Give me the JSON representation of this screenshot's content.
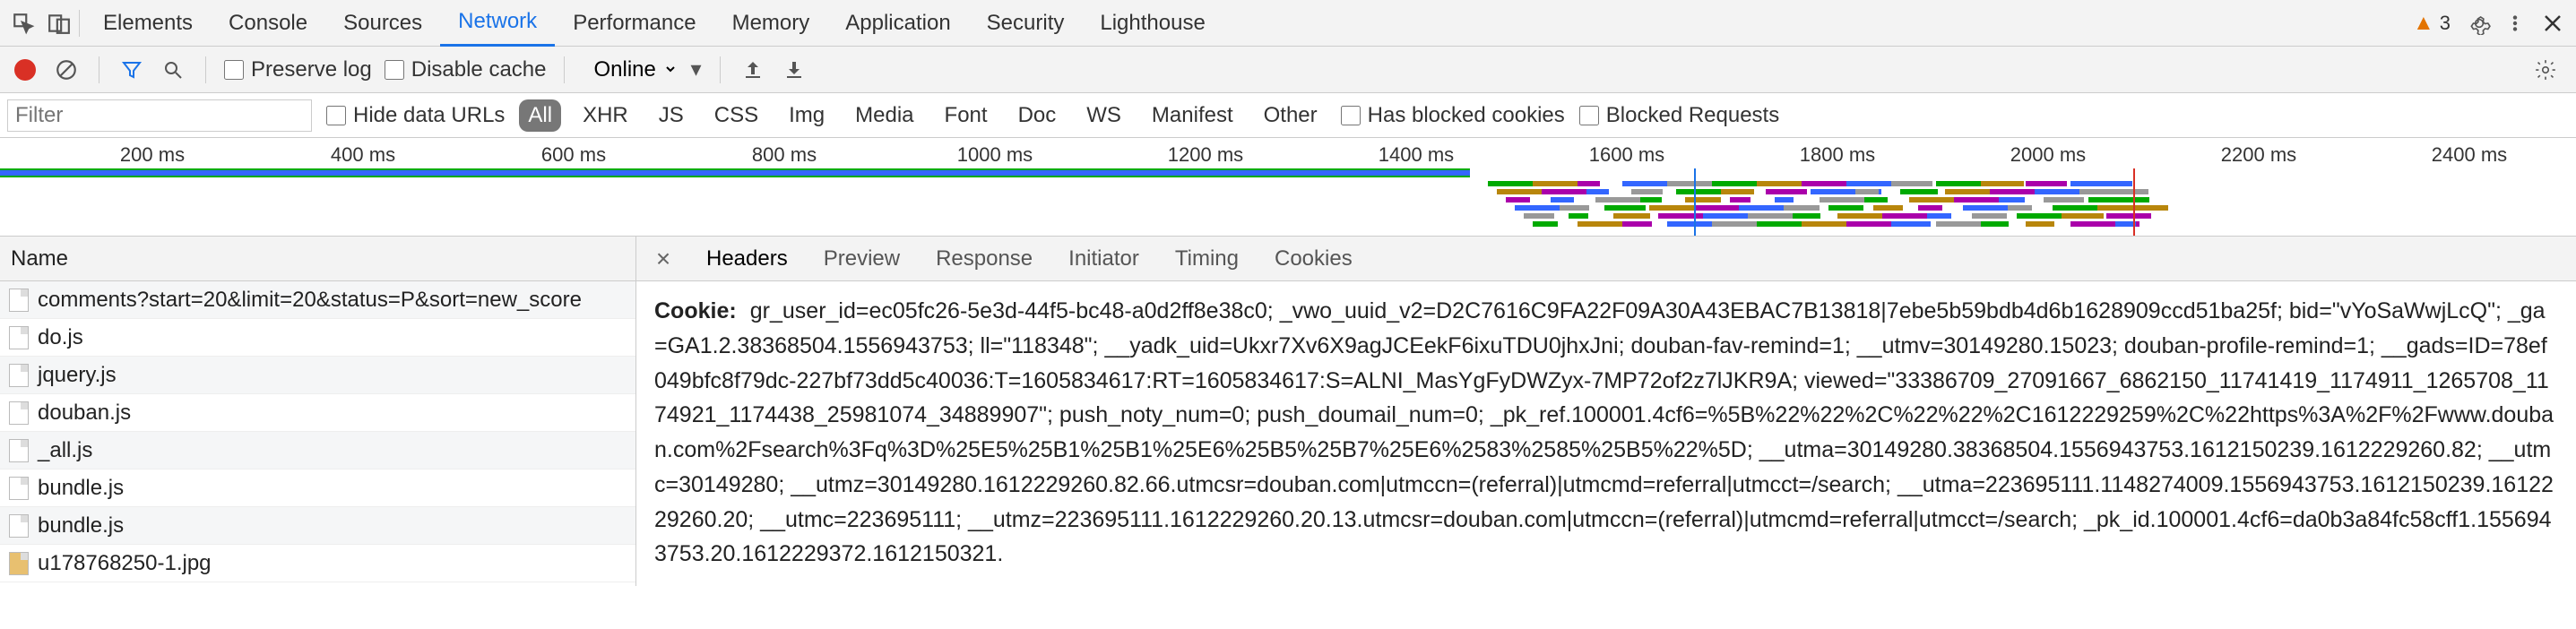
{
  "topTabs": [
    "Elements",
    "Console",
    "Sources",
    "Network",
    "Performance",
    "Memory",
    "Application",
    "Security",
    "Lighthouse"
  ],
  "topActive": "Network",
  "warnings": "3",
  "sub": {
    "preserve": "Preserve log",
    "disable": "Disable cache",
    "throttle": "Online"
  },
  "filter": {
    "placeholder": "Filter",
    "hideData": "Hide data URLs",
    "types": [
      "All",
      "XHR",
      "JS",
      "CSS",
      "Img",
      "Media",
      "Font",
      "Doc",
      "WS",
      "Manifest",
      "Other"
    ],
    "typeActive": "All",
    "blockedCookies": "Has blocked cookies",
    "blockedReq": "Blocked Requests"
  },
  "timeline": {
    "ticks": [
      "200 ms",
      "400 ms",
      "600 ms",
      "800 ms",
      "1000 ms",
      "1200 ms",
      "1400 ms",
      "1600 ms",
      "1800 ms",
      "2000 ms",
      "2200 ms",
      "2400 ms"
    ]
  },
  "nameHeader": "Name",
  "requests": [
    {
      "name": "comments?start=20&limit=20&status=P&sort=new_score",
      "img": false
    },
    {
      "name": "do.js",
      "img": false
    },
    {
      "name": "jquery.js",
      "img": false
    },
    {
      "name": "douban.js",
      "img": false
    },
    {
      "name": "_all.js",
      "img": false
    },
    {
      "name": "bundle.js",
      "img": false
    },
    {
      "name": "bundle.js",
      "img": false
    },
    {
      "name": "u178768250-1.jpg",
      "img": true
    }
  ],
  "detailTabs": [
    "Headers",
    "Preview",
    "Response",
    "Initiator",
    "Timing",
    "Cookies"
  ],
  "detailActive": "Headers",
  "cookieLabel": "Cookie:",
  "cookieValue": "gr_user_id=ec05fc26-5e3d-44f5-bc48-a0d2ff8e38c0; _vwo_uuid_v2=D2C7616C9FA22F09A30A43EBAC7B13818|7ebe5b59bdb4d6b1628909ccd51ba25f; bid=\"vYoSaWwjLcQ\"; _ga=GA1.2.38368504.1556943753; ll=\"118348\"; __yadk_uid=Ukxr7Xv6X9agJCEekF6ixuTDU0jhxJni; douban-fav-remind=1; __utmv=30149280.15023; douban-profile-remind=1; __gads=ID=78ef049bfc8f79dc-227bf73dd5c40036:T=1605834617:RT=1605834617:S=ALNI_MasYgFyDWZyx-7MP72of2z7lJKR9A; viewed=\"33386709_27091667_6862150_11741419_1174911_1265708_1174921_1174438_25981074_34889907\"; push_noty_num=0; push_doumail_num=0; _pk_ref.100001.4cf6=%5B%22%22%2C%22%22%2C1612229259%2C%22https%3A%2F%2Fwww.douban.com%2Fsearch%3Fq%3D%25E5%25B1%25B1%25E6%25B5%25B7%25E6%2583%2585%25B5%22%5D; __utma=30149280.38368504.1556943753.1612150239.1612229260.82; __utmc=30149280; __utmz=30149280.1612229260.82.66.utmcsr=douban.com|utmccn=(referral)|utmcmd=referral|utmcct=/search; __utma=223695111.1148274009.1556943753.1612150239.1612229260.20; __utmc=223695111; __utmz=223695111.1612229260.20.13.utmcsr=douban.com|utmccn=(referral)|utmcmd=referral|utmcct=/search; _pk_id.100001.4cf6=da0b3a84fc58cff1.1556943753.20.1612229372.1612150321."
}
